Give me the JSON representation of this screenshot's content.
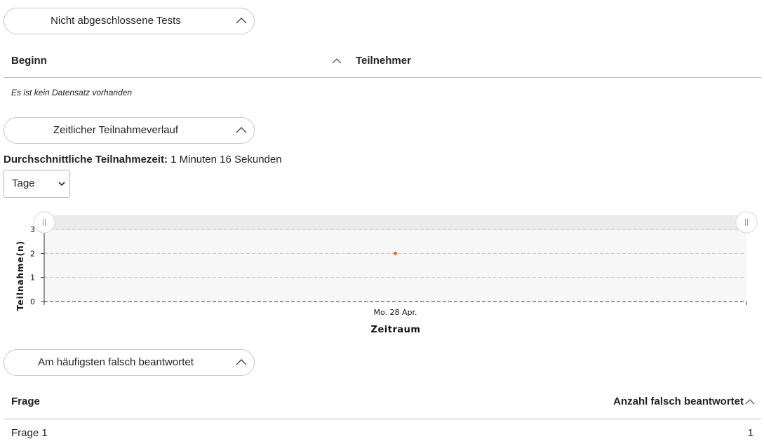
{
  "section_open_tests": {
    "title": "Nicht abgeschlossene Tests",
    "table": {
      "col_start": "Beginn",
      "col_participant": "Teilnehmer",
      "empty_message": "Es ist kein Datensatz vorhanden"
    }
  },
  "section_timeline": {
    "title": "Zeitlicher Teilnahmeverlauf",
    "avg_label": "Durchschnittliche Teilnahmezeit:",
    "avg_value": "1 Minuten 16 Sekunden",
    "period_select": {
      "selected": "Tage"
    }
  },
  "chart_data": {
    "type": "scatter",
    "title": "",
    "xlabel": "Zeitraum",
    "ylabel": "Teilnahme(n)",
    "ylim": [
      0,
      3
    ],
    "yticks": [
      "0",
      "1",
      "2",
      "3"
    ],
    "categories": [
      "Mo. 28 Apr."
    ],
    "values": [
      2
    ],
    "grid": "horizontal dashed",
    "point_color": "#f07018"
  },
  "section_wrong": {
    "title": "Am häufigsten falsch beantwortet",
    "table": {
      "col_question": "Frage",
      "col_count": "Anzahl falsch beantwortet",
      "rows": [
        {
          "question": "Frage 1",
          "count": "1"
        }
      ]
    }
  },
  "icons": {
    "collapse": "chevron-up-icon",
    "sort": "chevron-up-icon",
    "dropdown": "chevron-down-icon",
    "range_handle": "grip-handle-icon"
  }
}
